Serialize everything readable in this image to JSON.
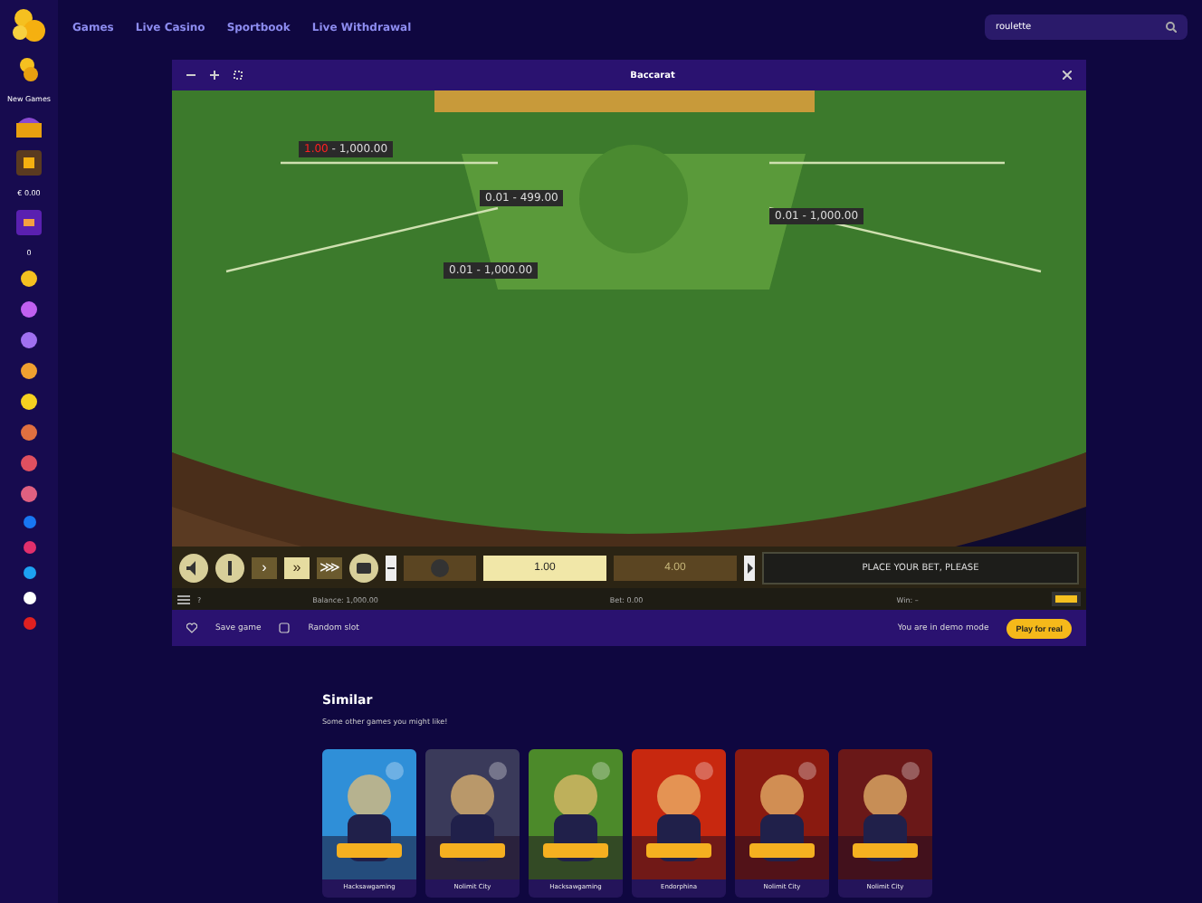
{
  "nav": {
    "links": [
      {
        "label": "Games",
        "selected": false
      },
      {
        "label": "Live Casino",
        "selected": false
      },
      {
        "label": "Sportbook",
        "selected": false
      },
      {
        "label": "Live Withdrawal",
        "selected": false
      }
    ],
    "search": {
      "value": "roulette"
    }
  },
  "sidebar": {
    "promo_label": "New Games",
    "wallet": "€ 0.00",
    "count": "0"
  },
  "game_window": {
    "title": "Baccarat",
    "limits": [
      {
        "low": "1.00",
        "high": " - 1,000.00",
        "warn": true
      },
      {
        "low": "0.01",
        "high": " - 499.00",
        "warn": false
      },
      {
        "low": "0.01",
        "high": " - 1,000.00",
        "warn": false
      },
      {
        "low": "0.01",
        "high": " - 1,000.00",
        "warn": false
      }
    ],
    "speeds": [
      {
        "label": "›",
        "selected": false
      },
      {
        "label": "»",
        "selected": true
      },
      {
        "label": "⋙",
        "selected": false
      }
    ],
    "chips": [
      {
        "value": "1.00",
        "selected": true
      },
      {
        "value": "4.00",
        "selected": false
      }
    ],
    "message": "PLACE YOUR BET, PLEASE",
    "help": "?",
    "balance": "Balance: 1,000.00",
    "bet": "Bet: 0.00",
    "win": "Win: –",
    "save": "Save game",
    "random": "Random slot",
    "demo": "You are in demo mode",
    "play": "Play for real"
  },
  "similar": {
    "title": "Similar",
    "subtitle": "Some other games you might like!",
    "games": [
      {
        "provider": "Hacksawgaming",
        "color": "#2f8fd8"
      },
      {
        "provider": "Nolimit City",
        "color": "#3a3a5a"
      },
      {
        "provider": "Hacksawgaming",
        "color": "#4c8a2a"
      },
      {
        "provider": "Endorphina",
        "color": "#c8280f"
      },
      {
        "provider": "Nolimit City",
        "color": "#8a1a10"
      },
      {
        "provider": "Nolimit City",
        "color": "#6a1818"
      }
    ]
  }
}
